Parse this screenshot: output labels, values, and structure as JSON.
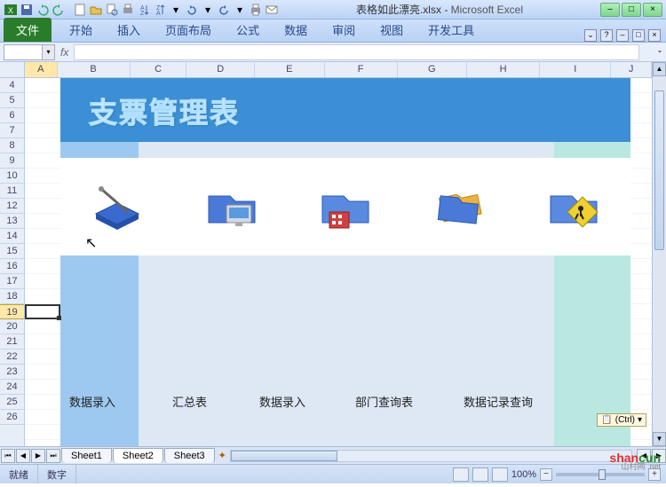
{
  "app_name": "Microsoft Excel",
  "file_name": "表格如此漂亮.xlsx",
  "title_separator": " - ",
  "qat_icons": [
    "excel-icon",
    "save-icon",
    "undo-icon",
    "redo-icon",
    "new-icon",
    "open-icon",
    "print-preview-icon",
    "spelling-icon",
    "sort-icon",
    "chart-icon",
    "dropdown-icon",
    "undo-split-icon",
    "redo-split-icon",
    "print-icon",
    "quick-print-icon"
  ],
  "win_buttons": [
    "–",
    "□",
    "×"
  ],
  "ribbon": {
    "file": "文件",
    "tabs": [
      "开始",
      "插入",
      "页面布局",
      "公式",
      "数据",
      "审阅",
      "视图",
      "开发工具"
    ]
  },
  "formula_bar": {
    "namebox": "",
    "fx": "fx",
    "formula": ""
  },
  "columns": [
    "A",
    "B",
    "C",
    "D",
    "E",
    "F",
    "G",
    "H",
    "I",
    "J"
  ],
  "first_row": 4,
  "last_row": 26,
  "selected_row": 19,
  "sheet_content": {
    "banner_title": "支票管理表",
    "icons": [
      {
        "name": "book-pen-icon"
      },
      {
        "name": "folder-monitor-icon"
      },
      {
        "name": "folder-building-icon"
      },
      {
        "name": "folders-stack-icon"
      },
      {
        "name": "folder-sign-icon"
      }
    ],
    "labels": [
      "数据录入",
      "汇总表",
      "数据录入",
      "部门查询表",
      "数据记录查询"
    ]
  },
  "sheet_tabs": {
    "items": [
      "Sheet1",
      "Sheet2",
      "Sheet3"
    ],
    "active": "Sheet2",
    "nav": [
      "⏮",
      "◀",
      "▶",
      "⏭"
    ]
  },
  "paste_options": {
    "icon": "📋",
    "label": "(Ctrl)",
    "arrow": "▾"
  },
  "status_bar": {
    "left": [
      "就绪",
      "数字"
    ],
    "zoom_pct": "100%",
    "zoom_minus": "−",
    "zoom_plus": "+"
  },
  "watermark": {
    "part1": "shan",
    "part2": "cun",
    "sub": "山村网 .net"
  }
}
